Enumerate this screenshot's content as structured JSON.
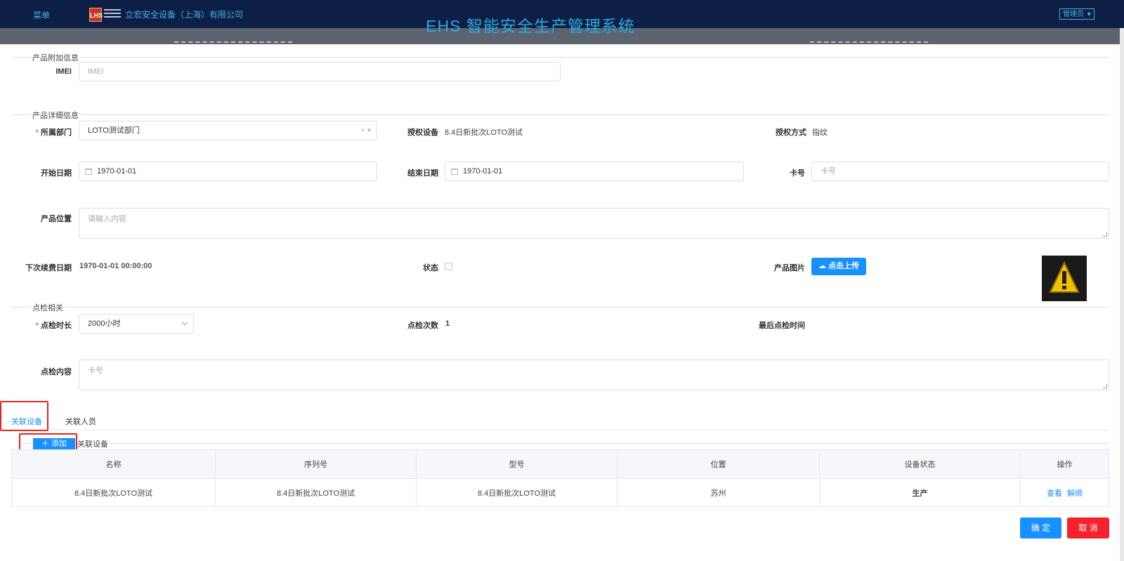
{
  "header": {
    "menu_label": "菜单",
    "logo_text": "LHS",
    "company": "立宏安全设备（上海）有限公司",
    "system_title": "EHS 智能安全生产管理系统",
    "user_menu": "管理员"
  },
  "sections": {
    "extra_info": "产品附加信息",
    "detail_info": "产品详细信息",
    "inspection": "点检相关"
  },
  "form": {
    "imei": {
      "label": "IMEI",
      "placeholder": "IMEI"
    },
    "department": {
      "label": "所属部门",
      "value": "LOTO测试部门"
    },
    "authorized_device": {
      "label": "授权设备",
      "value": "8.4日新批次LOTO测试"
    },
    "auth_method": {
      "label": "授权方式",
      "value": "指纹"
    },
    "start_date": {
      "label": "开始日期",
      "value": "1970-01-01"
    },
    "end_date": {
      "label": "结束日期",
      "value": "1970-01-01"
    },
    "card_no": {
      "label": "卡号",
      "placeholder": "卡号"
    },
    "location": {
      "label": "产品位置",
      "placeholder": "请输入内容"
    },
    "renewal_date": {
      "label": "下次续费日期",
      "value": "1970-01-01 00:00:00"
    },
    "status": {
      "label": "状态",
      "checked": false
    },
    "product_image": {
      "label": "产品图片",
      "upload_label": "点击上传"
    },
    "inspect_duration": {
      "label": "点检时长",
      "value": "2000小时"
    },
    "inspect_count": {
      "label": "点检次数",
      "value": "1"
    },
    "last_inspect": {
      "label": "最后点检时间",
      "value": ""
    },
    "inspect_content": {
      "label": "点检内容",
      "placeholder": "卡号"
    }
  },
  "tabs": [
    {
      "label": "关联设备",
      "active": true
    },
    {
      "label": "关联人员",
      "active": false
    }
  ],
  "related": {
    "add_button": "＋ 添加",
    "title": "关联设备",
    "columns": [
      "名称",
      "序列号",
      "型号",
      "位置",
      "设备状态",
      "操作"
    ],
    "rows": [
      {
        "name": "8.4日新批次LOTO测试",
        "serial": "8.4日新批次LOTO测试",
        "model": "8.4日新批次LOTO测试",
        "location": "苏州",
        "status": "生产",
        "actions": [
          "查看",
          "解绑"
        ]
      }
    ]
  },
  "footer": {
    "ok": "确 定",
    "cancel": "取 消"
  },
  "colors": {
    "primary": "#1890ff",
    "danger": "#f5222d",
    "success": "#1fae3a",
    "header_bg": "#0d1f44",
    "accent": "#2ca9e1"
  }
}
